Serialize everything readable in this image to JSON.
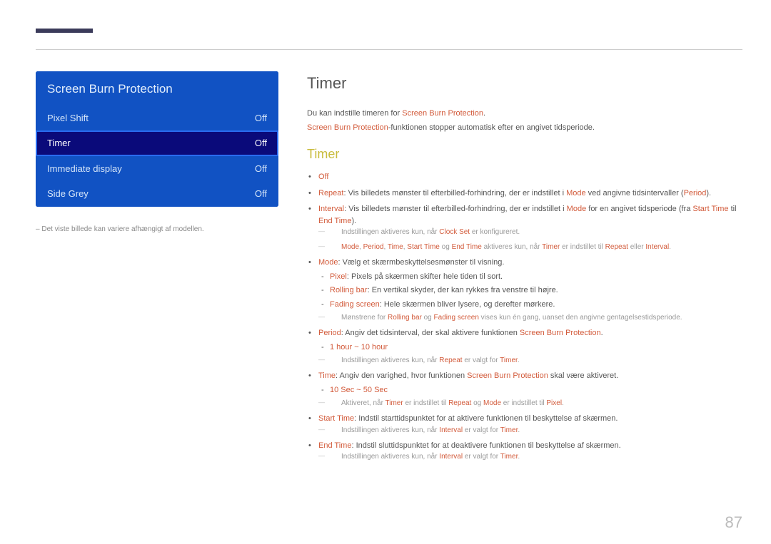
{
  "panel": {
    "title": "Screen Burn Protection",
    "rows": [
      {
        "label": "Pixel Shift",
        "value": "Off",
        "selected": false
      },
      {
        "label": "Timer",
        "value": "Off",
        "selected": true
      },
      {
        "label": "Immediate display",
        "value": "Off",
        "selected": false
      },
      {
        "label": "Side Grey",
        "value": "Off",
        "selected": false
      }
    ],
    "note_prefix": "– ",
    "note": "Det viste billede kan variere afhængigt af modellen."
  },
  "section_title": "Timer",
  "intro1_a": "Du kan indstille timeren for ",
  "intro1_b": "Screen Burn Protection",
  "intro1_c": ".",
  "intro2_a": "Screen Burn Protection",
  "intro2_b": "-funktionen stopper automatisk efter en angivet tidsperiode.",
  "sub_title": "Timer",
  "off_label": "Off",
  "repeat_label": "Repeat",
  "repeat_text_a": ": Vis billedets mønster til efterbilled-forhindring, der er indstillet i ",
  "mode_word": "Mode",
  "repeat_text_b": " ved angivne tidsintervaller (",
  "period_word": "Period",
  "repeat_text_c": ").",
  "interval_label": "Interval",
  "interval_text_a": ": Vis billedets mønster til efterbilled-forhindring, der er indstillet i ",
  "interval_text_b": " for en angivet tidsperiode (fra ",
  "starttime_word": "Start Time",
  "til_word": " til ",
  "endtime_word": "End Time",
  "interval_text_c": ").",
  "note1_a": "Indstillingen aktiveres kun, når ",
  "clockset_word": "Clock Set",
  "note1_b": " er konfigureret.",
  "note2_sep": ", ",
  "note2_og": " og ",
  "note2_a": " aktiveres kun, når ",
  "timer_word": "Timer",
  "note2_b": " er indstillet til ",
  "repeat_word": "Repeat",
  "note2_eller": " eller ",
  "interval_word": "Interval",
  "dot": ".",
  "mode_text": ": Vælg et skærmbeskyttelsesmønster til visning.",
  "pixel_word": "Pixel",
  "pixel_text": ": Pixels på skærmen skifter hele tiden til sort.",
  "rollingbar_word": "Rolling bar",
  "rollingbar_text": ": En vertikal skyder, der kan rykkes fra venstre til højre.",
  "fadingscreen_word": "Fading screen",
  "fadingscreen_text": ": Hele skærmen bliver lysere, og derefter mørkere.",
  "note3_a": "Mønstrene for ",
  "note3_og": " og ",
  "note3_b": " vises kun én gang, uanset den angivne gentagelsestidsperiode.",
  "period_text_a": ": Angiv det tidsinterval, der skal aktivere funktionen ",
  "sbp_word": "Screen Burn Protection",
  "period_range": "1 hour ~ 10 hour",
  "note4_a": "Indstillingen aktiveres kun, når ",
  "note4_b": " er valgt for ",
  "time_word": "Time",
  "time_text_a": ": Angiv den varighed, hvor funktionen ",
  "time_text_b": " skal være aktiveret.",
  "time_range": "10 Sec ~ 50 Sec",
  "note5_a": "Aktiveret, når ",
  "note5_b": " er indstillet til ",
  "note5_og": " og ",
  "starttime_text": ": Indstil starttidspunktet for at aktivere funktionen til beskyttelse af skærmen.",
  "note6_a": "Indstillingen aktiveres kun, når ",
  "note6_b": " er valgt for ",
  "endtime_text": ": Indstil sluttidspunktet for at deaktivere funktionen til beskyttelse af skærmen.",
  "page_number": "87"
}
